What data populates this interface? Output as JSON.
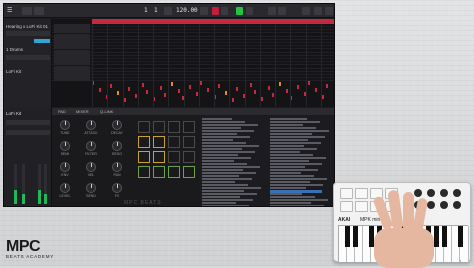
{
  "app": {
    "transport": {
      "bpm": "120.00",
      "bars": "1",
      "beat": "1",
      "counter": "1:1:0"
    },
    "left_panel": {
      "track_name": "Hearing x LoFi Kit 01",
      "program": "1 Drums",
      "sub": "LoFi Kit",
      "channel": "LoFi Kit"
    },
    "tabs": [
      {
        "label": "PAD"
      },
      {
        "label": "MIXER"
      },
      {
        "label": "Q-LINK"
      }
    ],
    "knob_labels": [
      "TUNE",
      "ATTACK",
      "DECAY",
      "SEMI",
      "FILTER",
      "RESO",
      "ENV",
      "VEL",
      "PAN",
      "LEVEL",
      "SEND",
      "FX"
    ],
    "brand_screen": "MPC BEATS"
  },
  "watermark": {
    "main": "MPC",
    "sub": "BEATS ACADEMY"
  },
  "controller": {
    "brand": "AKAI",
    "model": "MPK mini"
  },
  "colors": {
    "accent_red": "#c7283f",
    "accent_green": "#27c24a",
    "accent_blue": "#2fa7d4",
    "orange": "#e08a2a"
  }
}
